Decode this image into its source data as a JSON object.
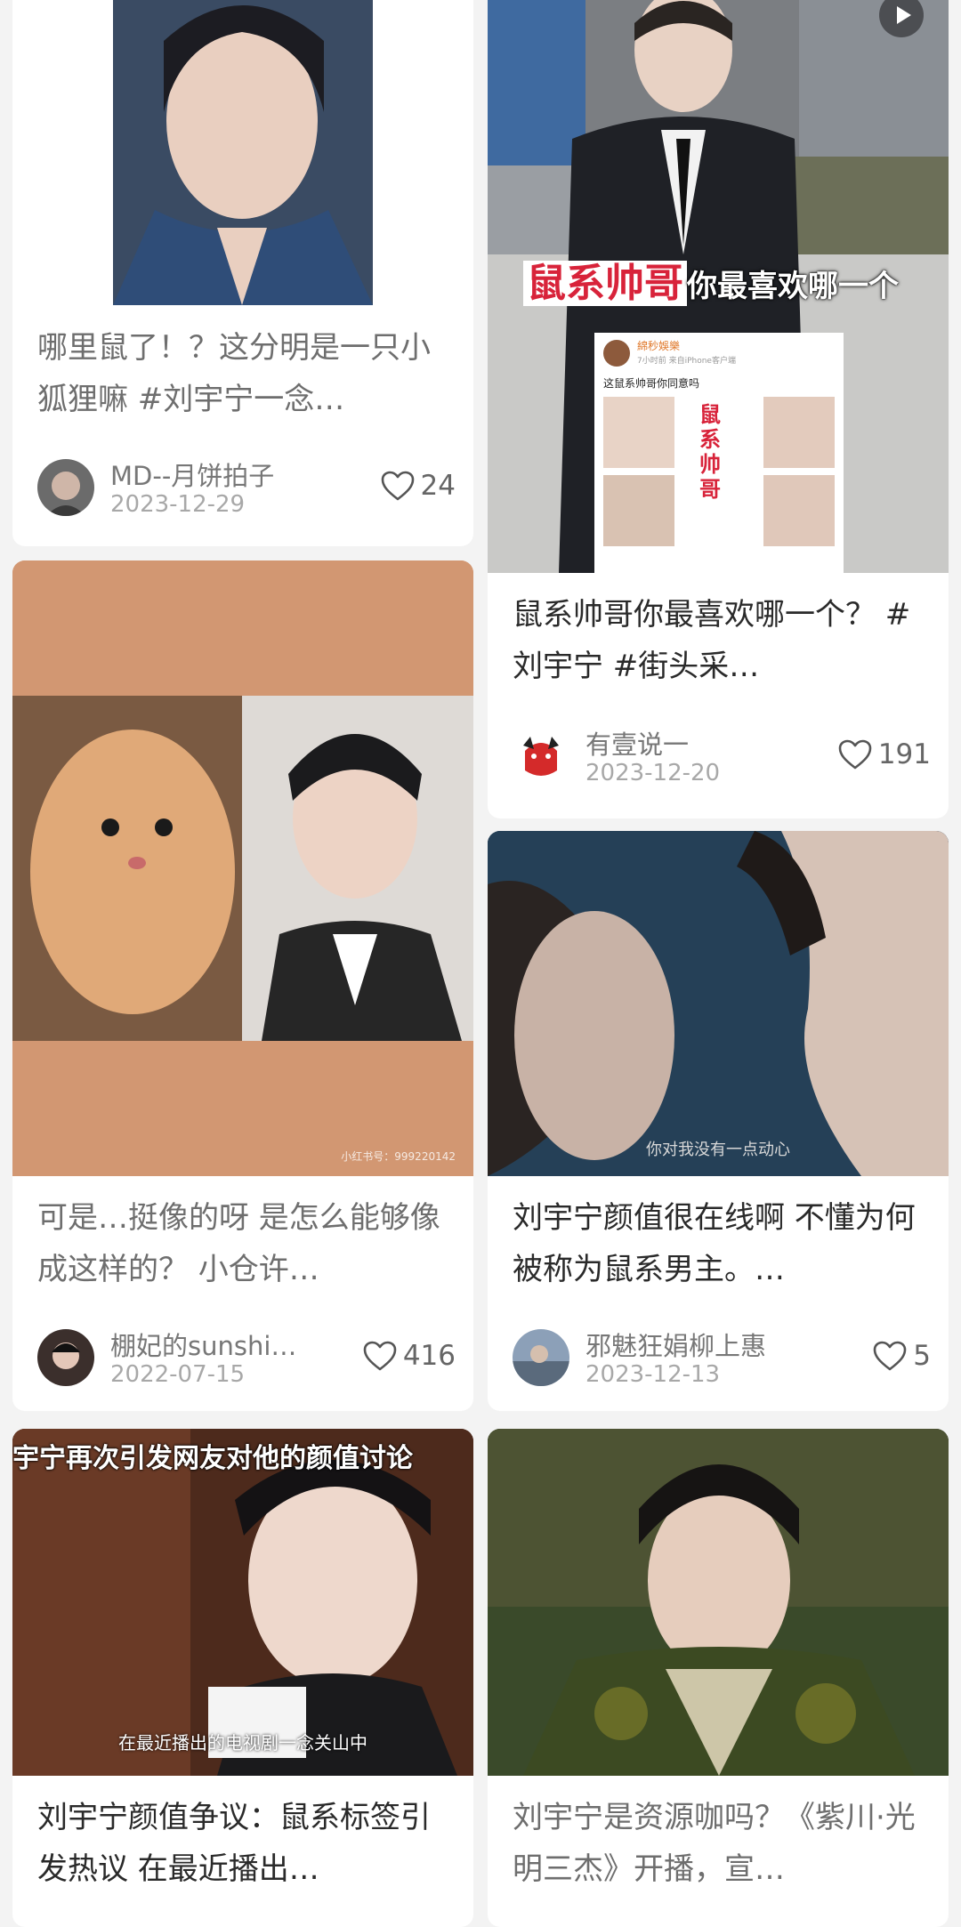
{
  "feed": {
    "cards": [
      {
        "title": "哪里鼠了！？这分明是一只小狐狸嘛 #刘宇宁一念…",
        "author": "MD--月饼拍子",
        "date": "2023-12-29",
        "likes": "24"
      },
      {
        "title": "鼠系帅哥你最喜欢哪一个？ #刘宇宁 #街头采…",
        "author": "有壹说一",
        "date": "2023-12-20",
        "likes": "191",
        "cover_caption": "鼠系帅哥",
        "cover_caption_suffix": "你最喜欢哪一个",
        "cover_post_user": "綿秒娛樂",
        "cover_post_meta": "7小时前 来自iPhone客户端",
        "cover_post_text": "这鼠系帅哥你同意吗",
        "cover_stamp": "鼠系帅哥"
      },
      {
        "title": "可是…挺像的呀 是怎么能够像成这样的？ 小仓许…",
        "author": "棚妃的sunshi…",
        "date": "2022-07-15",
        "likes": "416",
        "cover_watermark": "小红书号：999220142"
      },
      {
        "title": "刘宇宁颜值很在线啊 不懂为何被称为鼠系男主。…",
        "author": "邪魅狂娟柳上惠",
        "date": "2023-12-13",
        "likes": "5",
        "cover_subtitle": "你对我没有一点动心"
      },
      {
        "title": "刘宇宁颜值争议：鼠系标签引发热议 在最近播出…",
        "cover_top_text": "宇宁再次引发网友对他的颜值讨论",
        "cover_subtitle": "在最近播出的电视剧一念关山中"
      },
      {
        "title": "刘宇宁是资源咖吗？《紫川·光明三杰》开播，宣…"
      }
    ]
  },
  "colors": {
    "background": "#f3f3f3",
    "card": "#ffffff",
    "title": "#2a2a2a",
    "muted_title": "#6e6e6e",
    "meta": "#a8a8a8",
    "caption_red": "#d8233a"
  },
  "icons": {
    "like": "heart-outline-icon",
    "play": "play-icon"
  }
}
